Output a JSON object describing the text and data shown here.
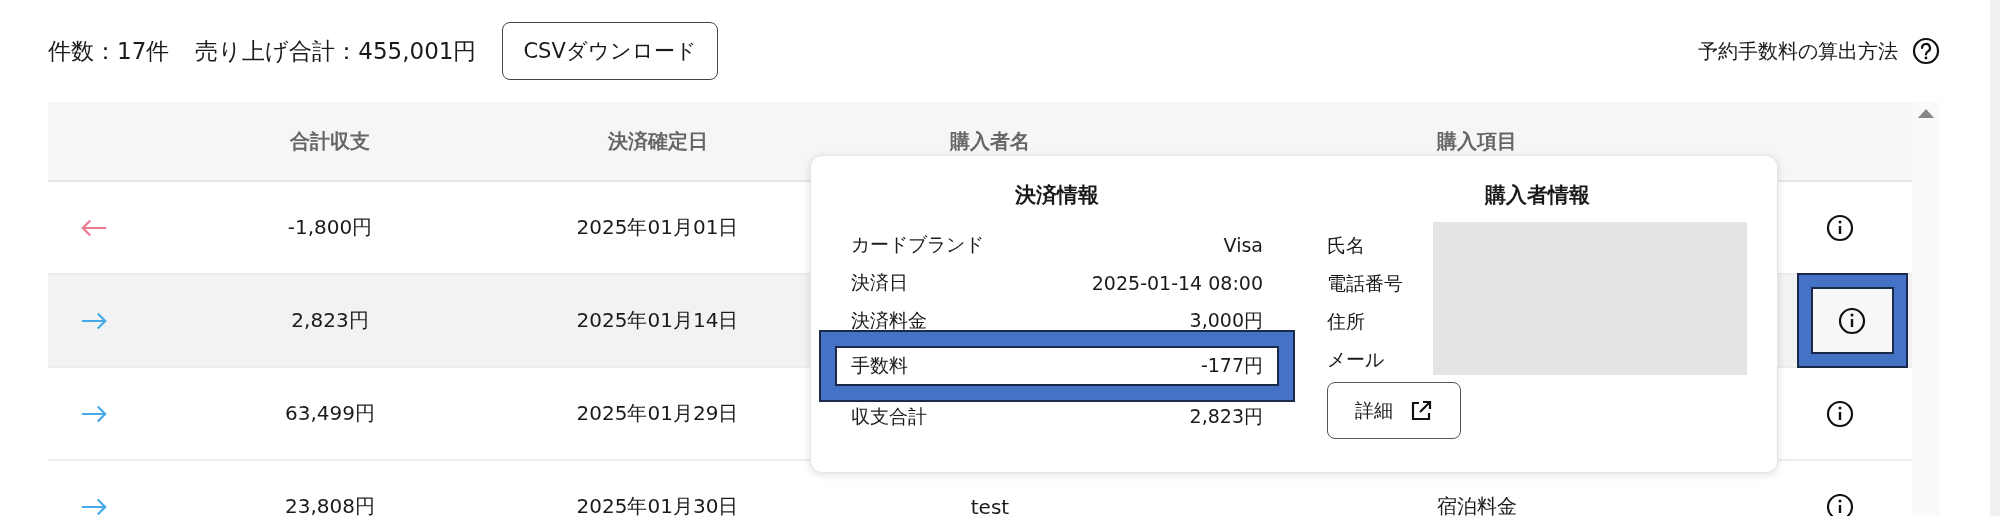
{
  "summary": {
    "count": "件数：17件",
    "total": "売り上げ合計：455,001円"
  },
  "csv_button": "CSVダウンロード",
  "fee_help_link": "予約手数料の算出方法",
  "table": {
    "columns": [
      "合計収支",
      "決済確定日",
      "購入者名",
      "購入項目"
    ],
    "rows": [
      {
        "kind": "out",
        "amount": "-1,800円",
        "date": "2025年01月01日",
        "selected": false,
        "highlighted": false
      },
      {
        "kind": "in",
        "amount": "2,823円",
        "date": "2025年01月14日",
        "selected": true,
        "highlighted": true
      },
      {
        "kind": "in",
        "amount": "63,499円",
        "date": "2025年01月29日",
        "selected": false,
        "highlighted": false
      },
      {
        "kind": "in",
        "amount": "23,808円",
        "date": "2025年01月30日",
        "buyer": "test",
        "item": "宿泊料金",
        "selected": false,
        "highlighted": false
      }
    ]
  },
  "popover": {
    "payment": {
      "title": "決済情報",
      "rows": [
        {
          "label": "カードブランド",
          "value": "Visa",
          "highlighted": false
        },
        {
          "label": "決済日",
          "value": "2025-01-14 08:00",
          "highlighted": false
        },
        {
          "label": "決済料金",
          "value": "3,000円",
          "highlighted": false
        },
        {
          "label": "手数料",
          "value": "-177円",
          "highlighted": true
        },
        {
          "label": "収支合計",
          "value": "2,823円",
          "highlighted": false
        }
      ]
    },
    "buyer": {
      "title": "購入者情報",
      "labels": [
        "氏名",
        "電話番号",
        "住所",
        "メール"
      ],
      "detail_button": "詳細"
    }
  }
}
